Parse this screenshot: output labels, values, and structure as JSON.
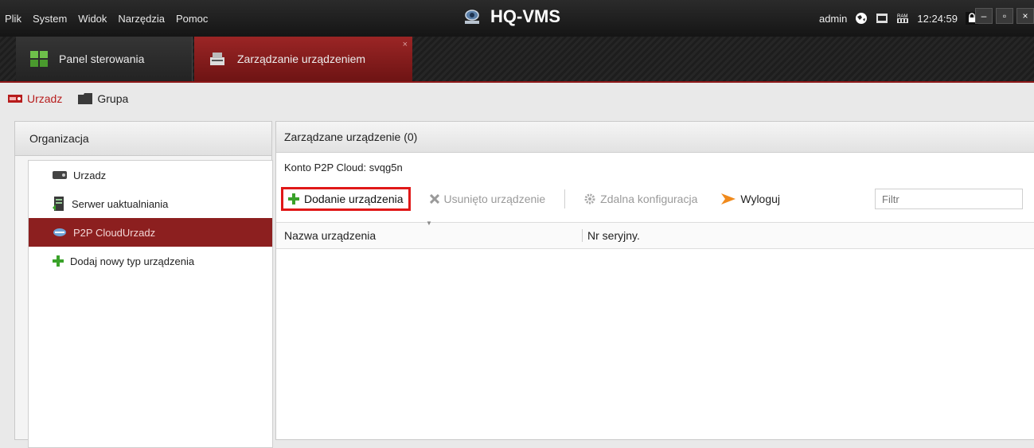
{
  "menu": [
    "Plik",
    "System",
    "Widok",
    "Narzędzia",
    "Pomoc"
  ],
  "app_title": "HQ-VMS",
  "status": {
    "user": "admin",
    "time": "12:24:59",
    "cpu_label": "CPU",
    "ram_label": "RAM"
  },
  "window_buttons": {
    "minimize": "–",
    "maximize": "▫",
    "close": "×"
  },
  "modules": [
    {
      "label": "Panel sterowania",
      "icon": "control-panel-icon",
      "active": false
    },
    {
      "label": "Zarządzanie urządzeniem",
      "icon": "device-management-icon",
      "active": true,
      "close": "×"
    }
  ],
  "subtabs": [
    {
      "label": "Urzadz",
      "icon": "device-icon",
      "active": true
    },
    {
      "label": "Grupa",
      "icon": "folder-icon",
      "active": false
    }
  ],
  "left_panel": {
    "header": "Organizacja",
    "items": [
      {
        "label": "Urzadz",
        "icon": "device-icon",
        "active": false
      },
      {
        "label": "Serwer uaktualniania",
        "icon": "server-icon",
        "active": false
      },
      {
        "label": "P2P CloudUrzadz",
        "icon": "cloud-device-icon",
        "active": true
      },
      {
        "label": "Dodaj nowy typ urządzenia",
        "icon": "plus-icon",
        "active": false
      }
    ]
  },
  "right_panel": {
    "header": "Zarządzane urządzenie (0)",
    "p2p_account_label": "Konto P2P Cloud:",
    "p2p_account_value": "svqg5n",
    "toolbar": {
      "add": "Dodanie urządzenia",
      "delete": "Usunięto urządzenie",
      "remote_config": "Zdalna konfiguracja",
      "logout": "Wyloguj"
    },
    "filter_placeholder": "Filtr",
    "columns": [
      "Nazwa urządzenia",
      "Nr seryjny."
    ]
  },
  "colors": {
    "accent": "#8c1f1f",
    "highlight_border": "#e01818",
    "add_icon": "#3aa22a"
  }
}
